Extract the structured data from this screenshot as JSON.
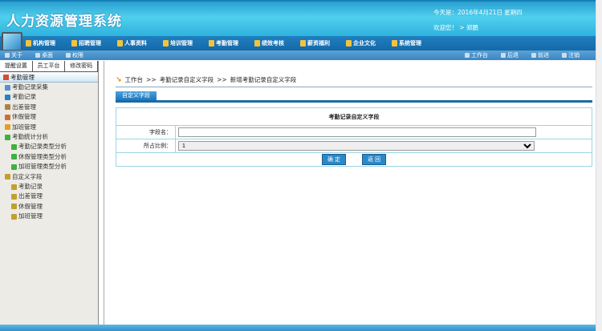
{
  "header": {
    "title": "人力资源管理系统",
    "date": "今天是：2016年4月21日  星期四",
    "welcome": "欢迎您！ > 郑鹏"
  },
  "menu": [
    "机构管理",
    "招聘管理",
    "人事资料",
    "培训管理",
    "考勤管理",
    "绩效考核",
    "薪资福利",
    "企业文化",
    "系统管理"
  ],
  "toolbar": {
    "left": [
      "关于",
      "桌面",
      "权限"
    ],
    "right": [
      "工作台",
      "后退",
      "前进",
      "注销"
    ]
  },
  "sidebar": {
    "tabs": [
      "提醒设置",
      "员工平台",
      "修改密码"
    ],
    "root": "考勤管理",
    "items": [
      {
        "label": "考勤记录采集",
        "level": 1,
        "color": "#5a8fd0"
      },
      {
        "label": "考勤记录",
        "level": 1,
        "color": "#2a7fc8"
      },
      {
        "label": "出差管理",
        "level": 1,
        "color": "#b08040"
      },
      {
        "label": "休假管理",
        "level": 1,
        "color": "#d07030"
      },
      {
        "label": "加班管理",
        "level": 1,
        "color": "#e0a020"
      },
      {
        "label": "考勤统计分析",
        "level": 1,
        "color": "#40b040"
      },
      {
        "label": "考勤记录类型分析",
        "level": 2,
        "color": "#40b040"
      },
      {
        "label": "休假管理类型分析",
        "level": 2,
        "color": "#40b040"
      },
      {
        "label": "加班管理类型分析",
        "level": 2,
        "color": "#40b040"
      },
      {
        "label": "自定义字段",
        "level": 1,
        "color": "#c0a030"
      },
      {
        "label": "考勤记录",
        "level": 2,
        "color": "#c0a030"
      },
      {
        "label": "出差管理",
        "level": 2,
        "color": "#c0a030"
      },
      {
        "label": "休假管理",
        "level": 2,
        "color": "#c0a030"
      },
      {
        "label": "加班管理",
        "level": 2,
        "color": "#c0a030"
      }
    ]
  },
  "main": {
    "breadcrumb": [
      "工作台",
      ">>",
      "考勤记录自定义字段",
      ">>",
      "新增考勤记录自定义字段"
    ],
    "tab": "自定义字段",
    "form": {
      "title": "考勤记录自定义字段",
      "field_label": "字段名：",
      "field_value": "",
      "ratio_label": "所占比例：",
      "ratio_value": "1",
      "ok": "确 定",
      "back": "返 回"
    }
  }
}
